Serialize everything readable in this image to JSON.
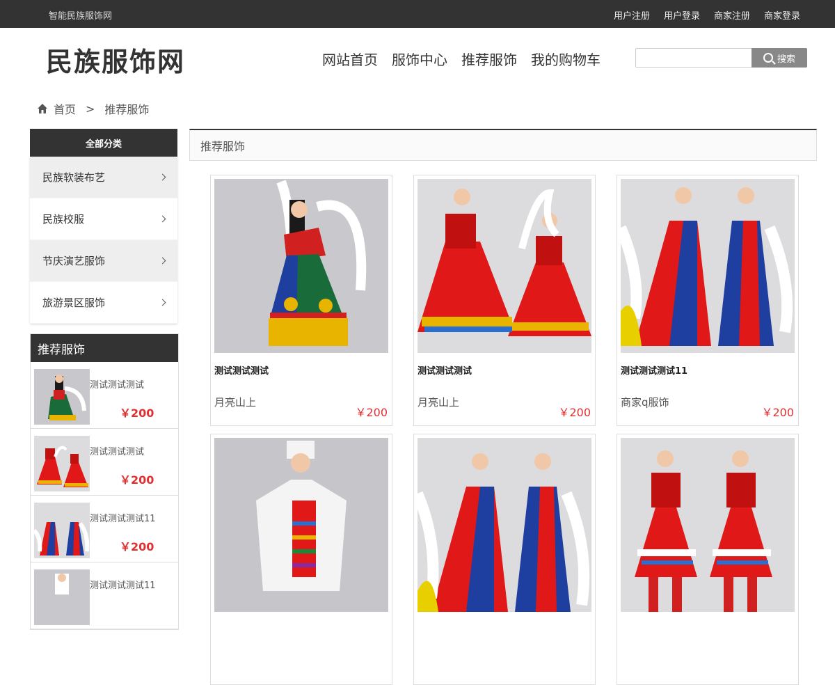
{
  "topbar": {
    "site_name": "智能民族服饰网",
    "links": [
      "用户注册",
      "用户登录",
      "商家注册",
      "商家登录"
    ]
  },
  "header": {
    "logo": "民族服饰网",
    "nav": [
      "网站首页",
      "服饰中心",
      "推荐服饰",
      "我的购物车"
    ],
    "search": {
      "placeholder": "",
      "button_label": "搜索"
    }
  },
  "breadcrumb": {
    "home": "首页",
    "separator": ">",
    "current": "推荐服饰"
  },
  "sidebar": {
    "category_title": "全部分类",
    "categories": [
      "民族软装布艺",
      "民族校服",
      "节庆演艺服饰",
      "旅游景区服饰"
    ],
    "recommend_title": "推荐服饰",
    "recommend_items": [
      {
        "name": "测试测试测试",
        "price": "￥200"
      },
      {
        "name": "测试测试测试",
        "price": "￥200"
      },
      {
        "name": "测试测试测试11",
        "price": "￥200"
      },
      {
        "name": "测试测试测试11",
        "price": ""
      }
    ]
  },
  "main": {
    "section_title": "推荐服饰",
    "products": [
      {
        "title": "测试测试测试",
        "shop": "月亮山上",
        "price": "￥200"
      },
      {
        "title": "测试测试测试",
        "shop": "月亮山上",
        "price": "￥200"
      },
      {
        "title": "测试测试测试11",
        "shop": "商家q服饰",
        "price": "￥200"
      },
      {
        "title": "",
        "shop": "",
        "price": ""
      },
      {
        "title": "",
        "shop": "",
        "price": ""
      },
      {
        "title": "",
        "shop": "",
        "price": ""
      }
    ]
  },
  "colors": {
    "dark": "#333333",
    "price": "#e03030",
    "red_costume": "#e01818",
    "blue_costume": "#1f3fa0",
    "green_costume": "#1a6b3a",
    "gold": "#e8b400"
  }
}
